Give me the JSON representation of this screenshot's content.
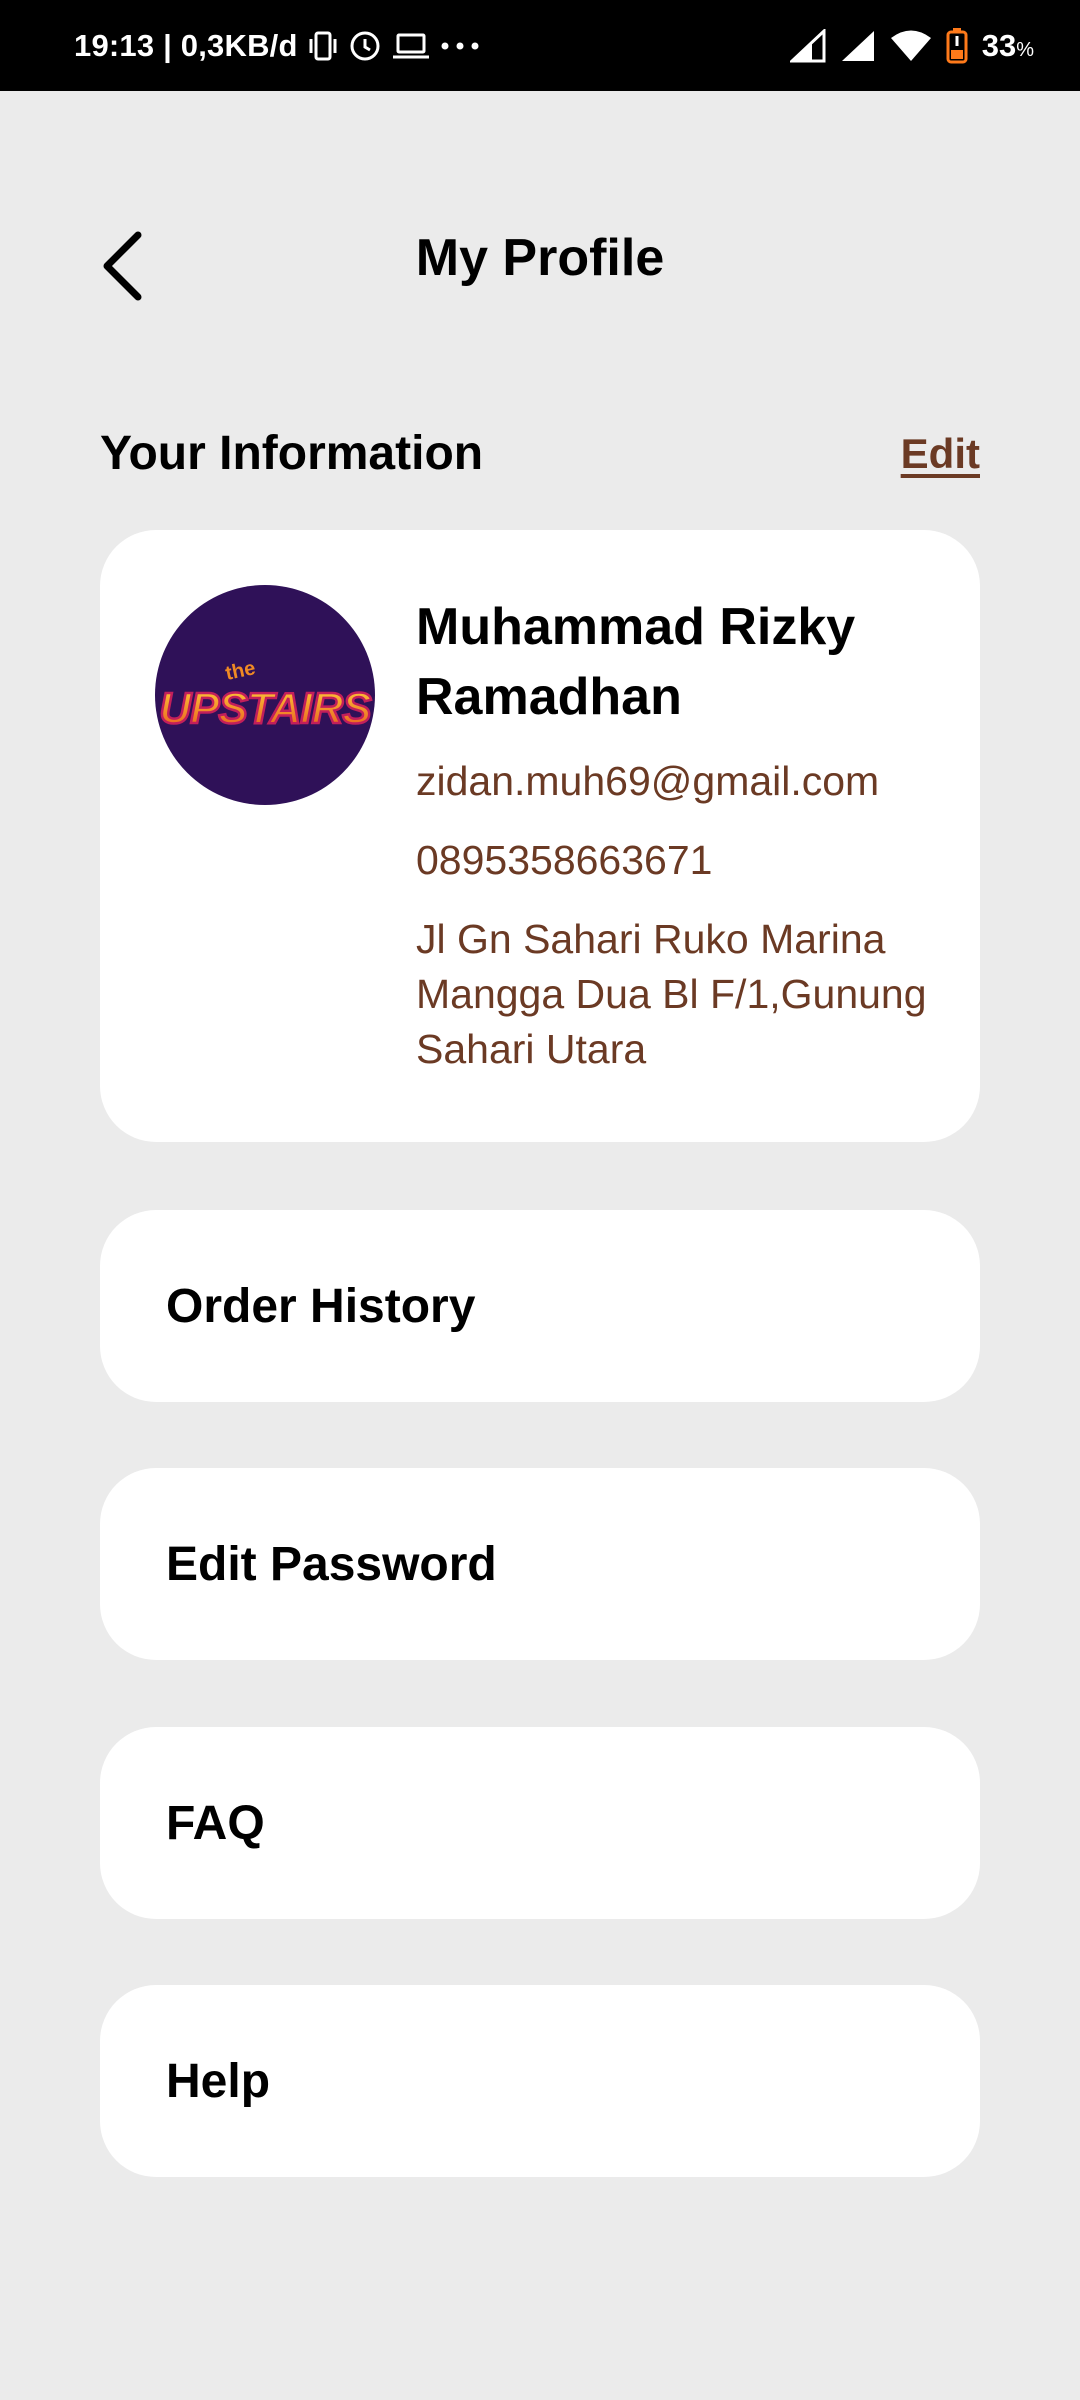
{
  "status_bar": {
    "time_and_speed": "19:13 | 0,3KB/d",
    "battery_percent": "33",
    "battery_unit": "%"
  },
  "header": {
    "title": "My Profile"
  },
  "section": {
    "title": "Your Information",
    "edit_label": "Edit"
  },
  "profile": {
    "name": "Muhammad Rizky Ramadhan",
    "email": "zidan.muh69@gmail.com",
    "phone": "0895358663671",
    "address": "Jl Gn Sahari Ruko Marina Mangga Dua Bl F/1,Gunung Sahari Utara",
    "avatar_logo_text": "the UPSTAIRS"
  },
  "menu": {
    "items": [
      {
        "label": "Order History"
      },
      {
        "label": "Edit Password"
      },
      {
        "label": "FAQ"
      },
      {
        "label": "Help"
      }
    ]
  },
  "colors": {
    "background": "#ebebeb",
    "card": "#ffffff",
    "accent_brown": "#6b3a24",
    "avatar_bg": "#2f1158"
  },
  "icons": {
    "back": "chevron-left-icon",
    "signal": "signal-icon",
    "wifi": "wifi-icon",
    "battery": "battery-icon",
    "vibrate": "vibrate-icon",
    "alarm": "alarm-clock-icon",
    "laptop": "laptop-icon",
    "more": "more-dots-icon"
  }
}
